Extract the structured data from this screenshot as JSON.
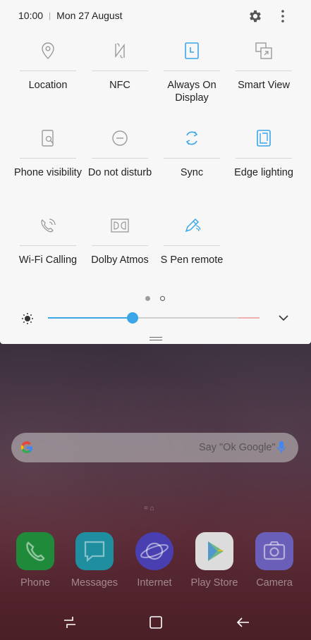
{
  "status": {
    "time": "10:00",
    "date": "Mon 27 August"
  },
  "tiles": [
    {
      "label": "Location",
      "icon": "location-icon",
      "active": false
    },
    {
      "label": "NFC",
      "icon": "nfc-icon",
      "active": false
    },
    {
      "label": "Always On Display",
      "icon": "always-on-display-icon",
      "active": true
    },
    {
      "label": "Smart View",
      "icon": "smart-view-icon",
      "active": false
    },
    {
      "label": "Phone visibility",
      "icon": "phone-visibility-icon",
      "active": false
    },
    {
      "label": "Do not disturb",
      "icon": "do-not-disturb-icon",
      "active": false
    },
    {
      "label": "Sync",
      "icon": "sync-icon",
      "active": true
    },
    {
      "label": "Edge lighting",
      "icon": "edge-lighting-icon",
      "active": true
    },
    {
      "label": "Wi-Fi Calling",
      "icon": "wifi-calling-icon",
      "active": false
    },
    {
      "label": "Dolby Atmos",
      "icon": "dolby-atmos-icon",
      "active": false
    },
    {
      "label": "S Pen remote",
      "icon": "s-pen-remote-icon",
      "active": true
    }
  ],
  "brightness": {
    "level": 0.4
  },
  "search": {
    "hint": "Say \"Ok Google\""
  },
  "apps": [
    {
      "name": "Phone",
      "icon": "phone-icon",
      "color": "#1f8a3a"
    },
    {
      "name": "Messages",
      "icon": "messages-icon",
      "color": "#1f8fa0"
    },
    {
      "name": "Internet",
      "icon": "internet-icon",
      "color": "#4a3fb0"
    },
    {
      "name": "Play Store",
      "icon": "play-store-icon",
      "color": "#e6e6e6"
    },
    {
      "name": "Camera",
      "icon": "camera-icon",
      "color": "#6a5fb8"
    }
  ],
  "colors": {
    "accent": "#3aa6e8",
    "inactive_icon": "#9a9a9a"
  }
}
